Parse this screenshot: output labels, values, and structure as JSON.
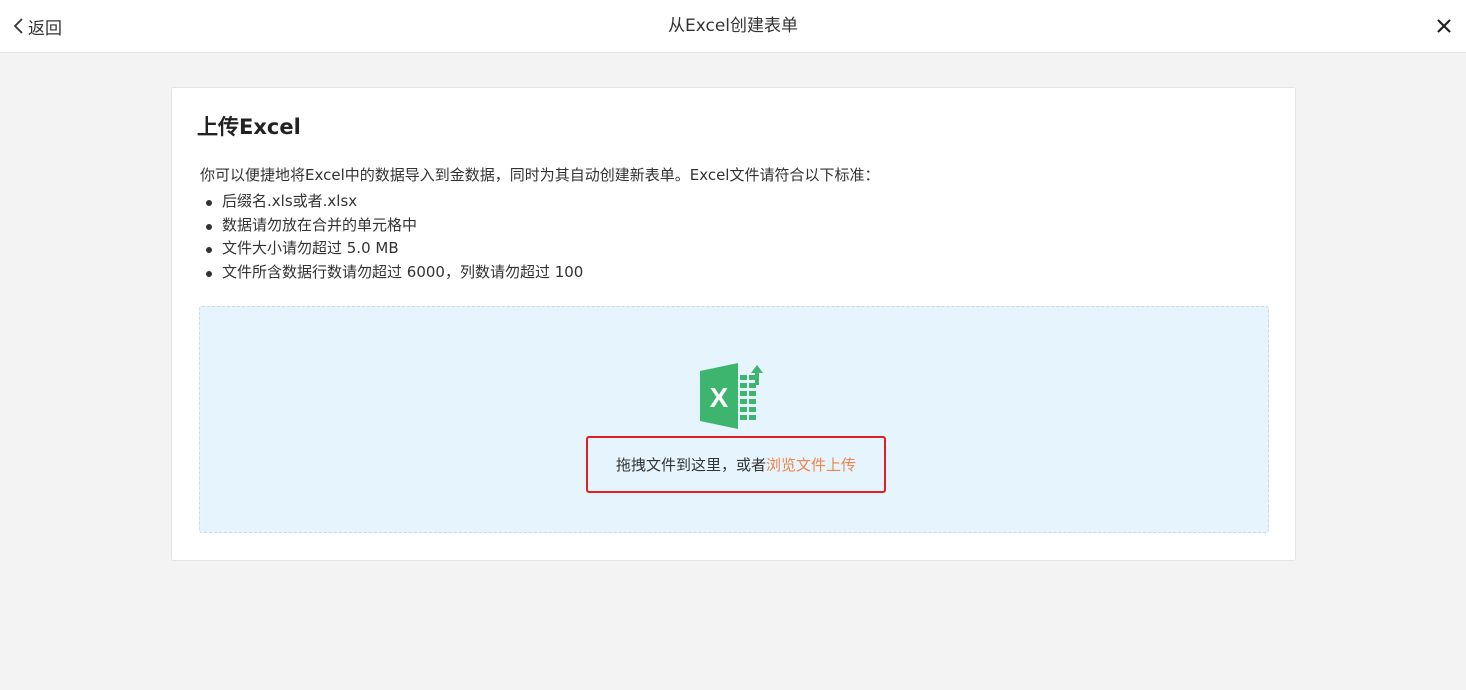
{
  "header": {
    "back_label": "返回",
    "title": "从Excel创建表单"
  },
  "card": {
    "heading": "上传Excel",
    "description": "你可以便捷地将Excel中的数据导入到金数据，同时为其自动创建新表单。Excel文件请符合以下标准：",
    "rules": [
      "后缀名.xls或者.xlsx",
      "数据请勿放在合并的单元格中",
      "文件大小请勿超过 5.0 MB",
      "文件所含数据行数请勿超过 6000，列数请勿超过 100"
    ]
  },
  "dropzone": {
    "icon": "excel-upload-icon",
    "hint_text": "拖拽文件到这里，或者",
    "browse_link": "浏览文件上传"
  },
  "colors": {
    "excel_green": "#3db56f",
    "link_orange": "#f0844a",
    "dropzone_bg": "#e6f4fd",
    "highlight_red": "#e02020"
  }
}
